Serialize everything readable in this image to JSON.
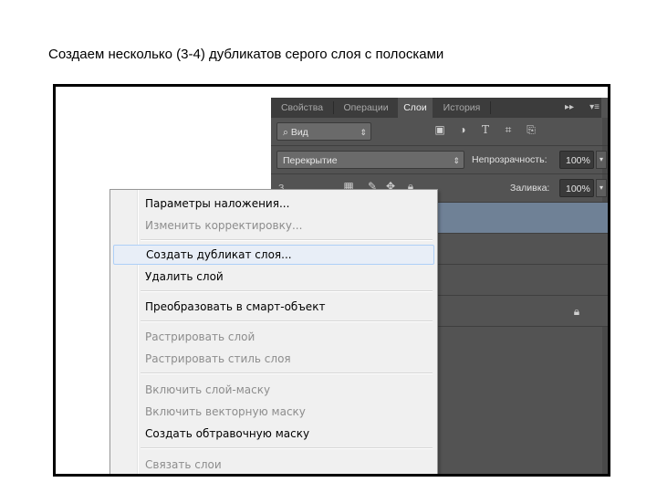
{
  "caption": "Создаем несколько (3-4) дубликатов серого слоя с полосками",
  "panel": {
    "tabs": [
      "Свойства",
      "Операции",
      "Слои",
      "История"
    ],
    "active_tab": "Слои",
    "collapse_glyph": "▸▸",
    "menu_glyph": "▾≡",
    "filter_label": "Вид",
    "blend_mode": "Перекрытие",
    "opacity_label": "Непрозрачность:",
    "opacity_value": "100%",
    "fill_label": "Заливка:",
    "fill_value": "100%",
    "lock_row_fragment": "З",
    "icons": [
      "search-icon",
      "image-filter-icon",
      "adjustment-filter-icon",
      "type-filter-icon",
      "shape-filter-icon",
      "smart-object-filter-icon",
      "lock-icon"
    ]
  },
  "context_menu": {
    "items": [
      {
        "label": "Параметры наложения...",
        "enabled": true
      },
      {
        "label": "Изменить корректировку...",
        "enabled": false
      },
      {
        "label": "Создать дубликат слоя...",
        "enabled": true,
        "highlighted": true
      },
      {
        "label": "Удалить слой",
        "enabled": true
      },
      {
        "label": "Преобразовать в смарт-объект",
        "enabled": true
      },
      {
        "label": "Растрировать слой",
        "enabled": false
      },
      {
        "label": "Растрировать стиль слоя",
        "enabled": false
      },
      {
        "label": "Включить слой-маску",
        "enabled": false
      },
      {
        "label": "Включить векторную маску",
        "enabled": false
      },
      {
        "label": "Создать обтравочную маску",
        "enabled": true
      },
      {
        "label": "Связать слои",
        "enabled": false
      }
    ]
  }
}
